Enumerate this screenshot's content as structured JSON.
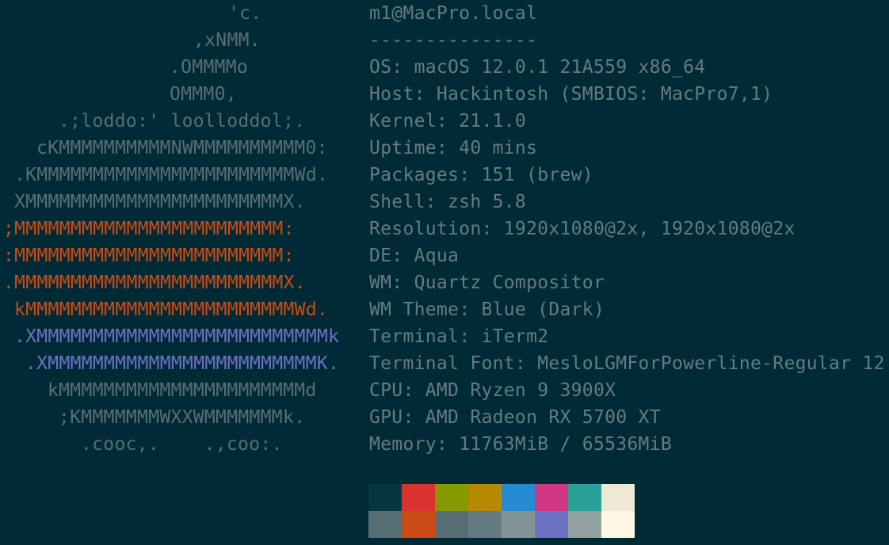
{
  "logo": {
    "lines": [
      {
        "text": "'c.",
        "color": "#586e75"
      },
      {
        "text": ",xNMM.",
        "color": "#586e75"
      },
      {
        "text": ".OMMMMo",
        "color": "#586e75"
      },
      {
        "text": "OMMM0,",
        "color": "#586e75"
      },
      {
        "text": ".;loddo:' loolloddol;.",
        "color": "#586e75"
      },
      {
        "text": "cKMMMMMMMMMMNWMMMMMMMMMM0:",
        "color": "#586e75"
      },
      {
        "text": ".KMMMMMMMMMMMMMMMMMMMMMMMWd.",
        "color": "#586e75"
      },
      {
        "text": "XMMMMMMMMMMMMMMMMMMMMMMMX.",
        "color": "#586e75"
      },
      {
        "text": ";MMMMMMMMMMMMMMMMMMMMMMMM:",
        "color": "#cb4b16"
      },
      {
        "text": ":MMMMMMMMMMMMMMMMMMMMMMMM:",
        "color": "#cb4b16"
      },
      {
        "text": ".MMMMMMMMMMMMMMMMMMMMMMMMX.",
        "color": "#cb4b16"
      },
      {
        "text": "kMMMMMMMMMMMMMMMMMMMMMMMMWd.",
        "color": "#cb4b16"
      },
      {
        "text": ".XMMMMMMMMMMMMMMMMMMMMMMMMMMk",
        "color": "#6c71c4"
      },
      {
        "text": ".XMMMMMMMMMMMMMMMMMMMMMMMMK.",
        "color": "#6c71c4"
      },
      {
        "text": "kMMMMMMMMMMMMMMMMMMMMMMd",
        "color": "#586e75"
      },
      {
        "text": ";KMMMMMMMWXXWMMMMMMMk.",
        "color": "#586e75"
      },
      {
        "text": ".cooc,.    .,coo:.",
        "color": "#586e75"
      }
    ]
  },
  "info": {
    "header": "m1@MacPro.local",
    "separator": "---------------",
    "fields": [
      {
        "key": "OS",
        "value": "macOS 12.0.1 21A559 x86_64"
      },
      {
        "key": "Host",
        "value": "Hackintosh (SMBIOS: MacPro7,1)"
      },
      {
        "key": "Kernel",
        "value": "21.1.0"
      },
      {
        "key": "Uptime",
        "value": "40 mins"
      },
      {
        "key": "Packages",
        "value": "151 (brew)"
      },
      {
        "key": "Shell",
        "value": "zsh 5.8"
      },
      {
        "key": "Resolution",
        "value": "1920x1080@2x, 1920x1080@2x"
      },
      {
        "key": "DE",
        "value": "Aqua"
      },
      {
        "key": "WM",
        "value": "Quartz Compositor"
      },
      {
        "key": "WM Theme",
        "value": "Blue (Dark)"
      },
      {
        "key": "Terminal",
        "value": "iTerm2"
      },
      {
        "key": "Terminal Font",
        "value": "MesloLGMForPowerline-Regular 12"
      },
      {
        "key": "CPU",
        "value": "AMD Ryzen 9 3900X"
      },
      {
        "key": "GPU",
        "value": "AMD Radeon RX 5700 XT"
      },
      {
        "key": "Memory",
        "value": "11763MiB / 65536MiB"
      }
    ]
  },
  "palette": {
    "normal": [
      "#073642",
      "#dc322f",
      "#859900",
      "#b58900",
      "#268bd2",
      "#d33682",
      "#2aa198",
      "#eee8d5"
    ],
    "bright": [
      "#586e75",
      "#cb4b16",
      "#586e75",
      "#657b83",
      "#839496",
      "#6c71c4",
      "#93a1a1",
      "#fdf6e3"
    ]
  }
}
